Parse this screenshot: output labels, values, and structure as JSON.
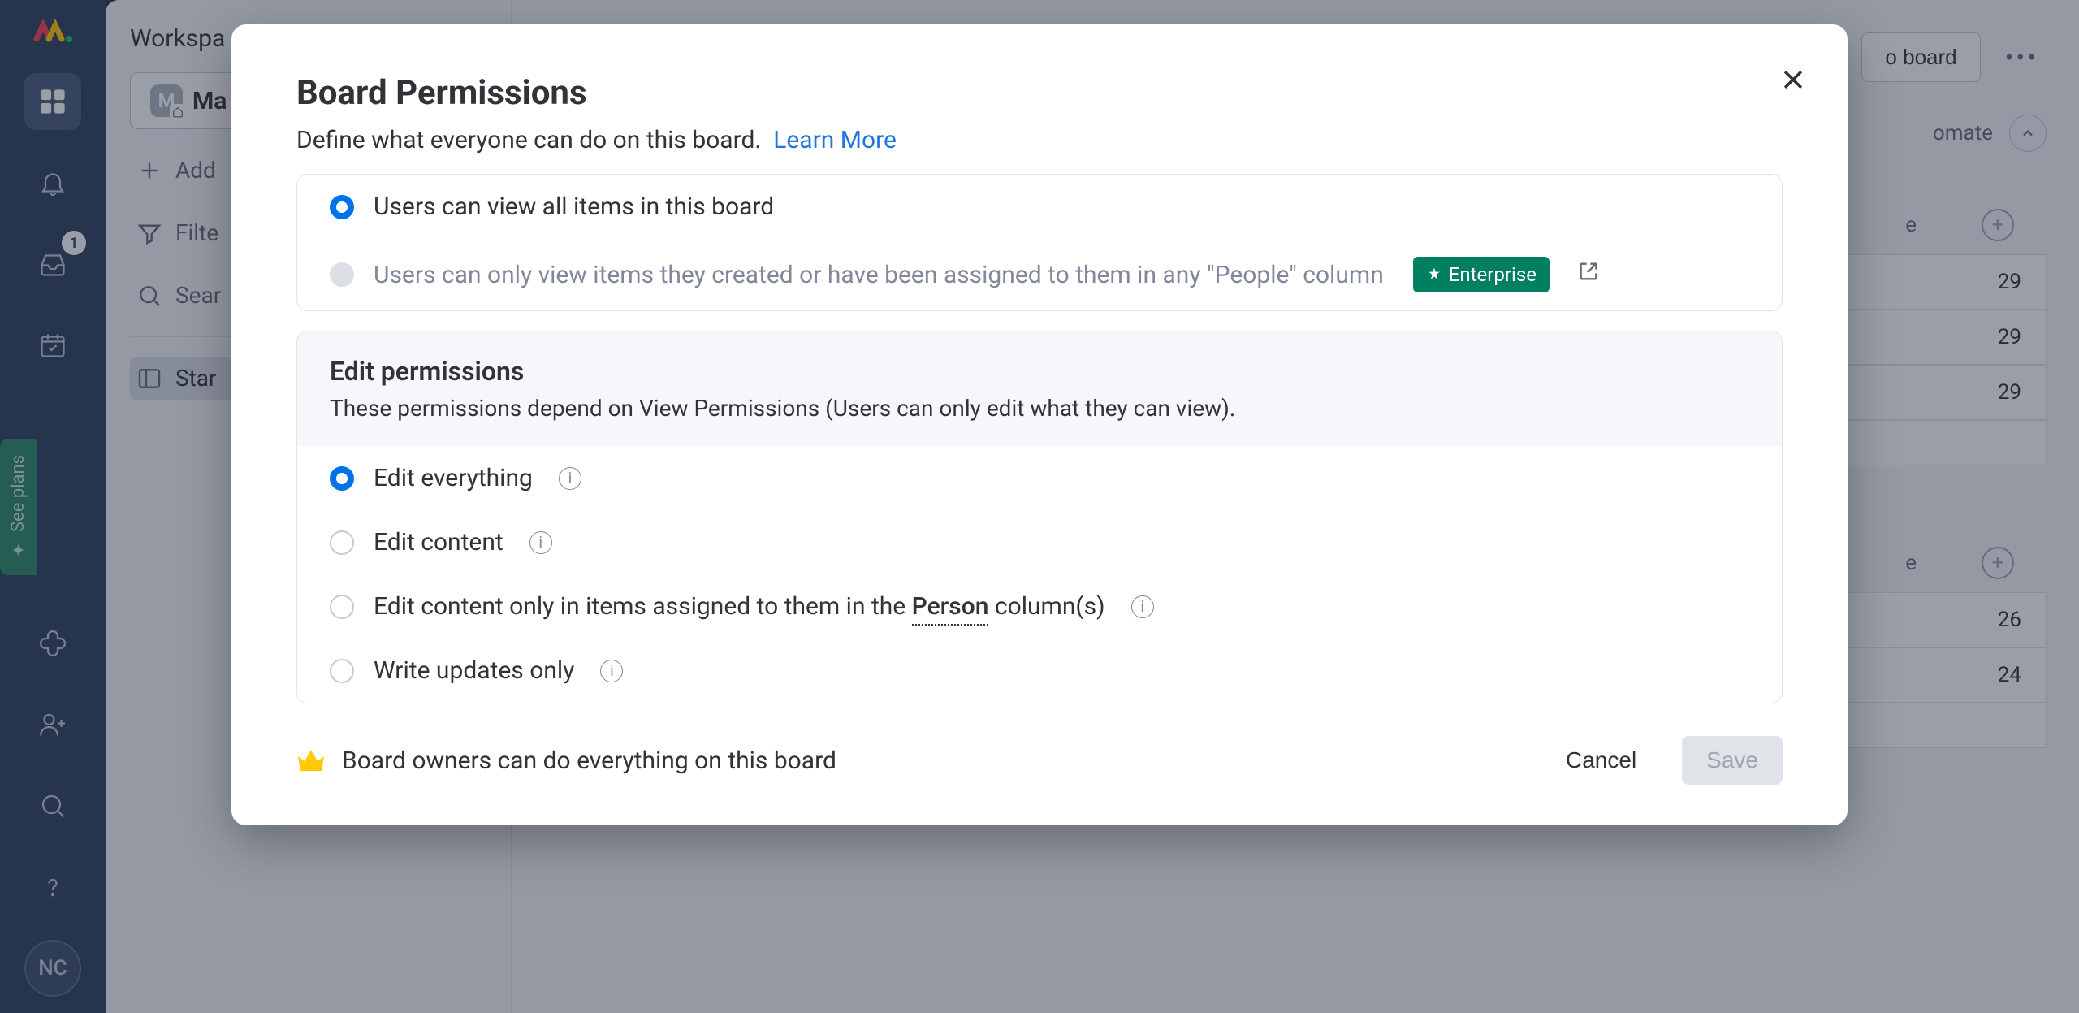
{
  "sidebar": {
    "badge_count": "1",
    "see_plans_label": "See plans",
    "avatar_initials": "NC"
  },
  "left_panel": {
    "workspace_label": "Workspa",
    "board_icon_letter": "M",
    "board_name": "Ma",
    "add_label": "Add",
    "filter_label": "Filte",
    "search_label": "Sear",
    "start_label": "Star"
  },
  "content": {
    "board_button": "o board",
    "automate_label": "omate",
    "column_label_e": "e",
    "rows_group1": [
      "29",
      "29",
      "29"
    ],
    "rows_group2": [
      "26",
      "24"
    ]
  },
  "modal": {
    "title": "Board Permissions",
    "subtitle": "Define what everyone can do on this board.",
    "learn_more": "Learn More",
    "view_option_all": "Users can view all items in this board",
    "view_option_assigned": "Users can only view items they created or have been assigned to them in any \"People\" column",
    "enterprise_label": "Enterprise",
    "edit_section_title": "Edit permissions",
    "edit_section_desc": "These permissions depend on View Permissions (Users can only edit what they can view).",
    "edit_options": {
      "everything": "Edit everything",
      "content": "Edit content",
      "assigned_pre": "Edit content only in items assigned to them in the ",
      "assigned_person": "Person",
      "assigned_post": " column(s)",
      "updates": "Write updates only"
    },
    "footer_note": "Board owners can do everything on this board",
    "cancel": "Cancel",
    "save": "Save"
  }
}
